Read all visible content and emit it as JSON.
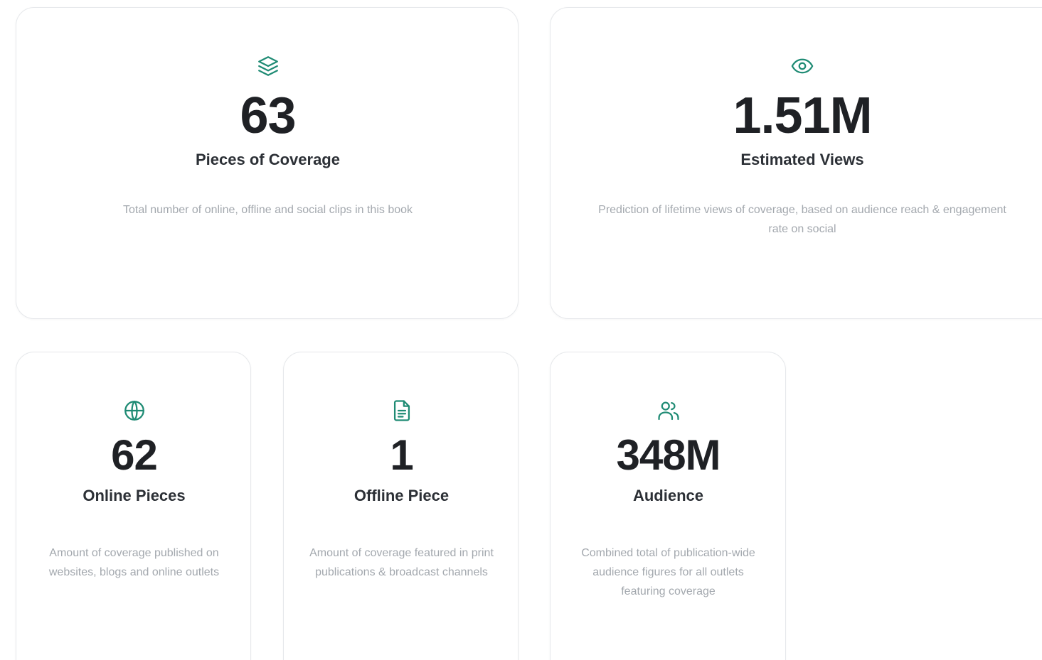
{
  "colors": {
    "accent": "#1f8b74",
    "value_text": "#1f2125",
    "label_text": "#2c3036",
    "description_text": "#a3a8ae",
    "card_border": "#e6e8eb"
  },
  "cards": {
    "coverage": {
      "icon": "layers-icon",
      "value": "63",
      "label": "Pieces of Coverage",
      "description": "Total number of online, offline and social clips in this book"
    },
    "views": {
      "icon": "eye-icon",
      "value": "1.51M",
      "label": "Estimated Views",
      "description": "Prediction of lifetime views of coverage, based on audience reach & engagement rate on social"
    },
    "online": {
      "icon": "globe-icon",
      "value": "62",
      "label": "Online Pieces",
      "description": "Amount of coverage published on websites, blogs and online outlets"
    },
    "offline": {
      "icon": "document-icon",
      "value": "1",
      "label": "Offline Piece",
      "description": "Amount of coverage featured in print publications & broadcast channels"
    },
    "audience": {
      "icon": "users-icon",
      "value": "348M",
      "label": "Audience",
      "description": "Combined total of publication-wide audience figures for all outlets featuring coverage"
    }
  }
}
